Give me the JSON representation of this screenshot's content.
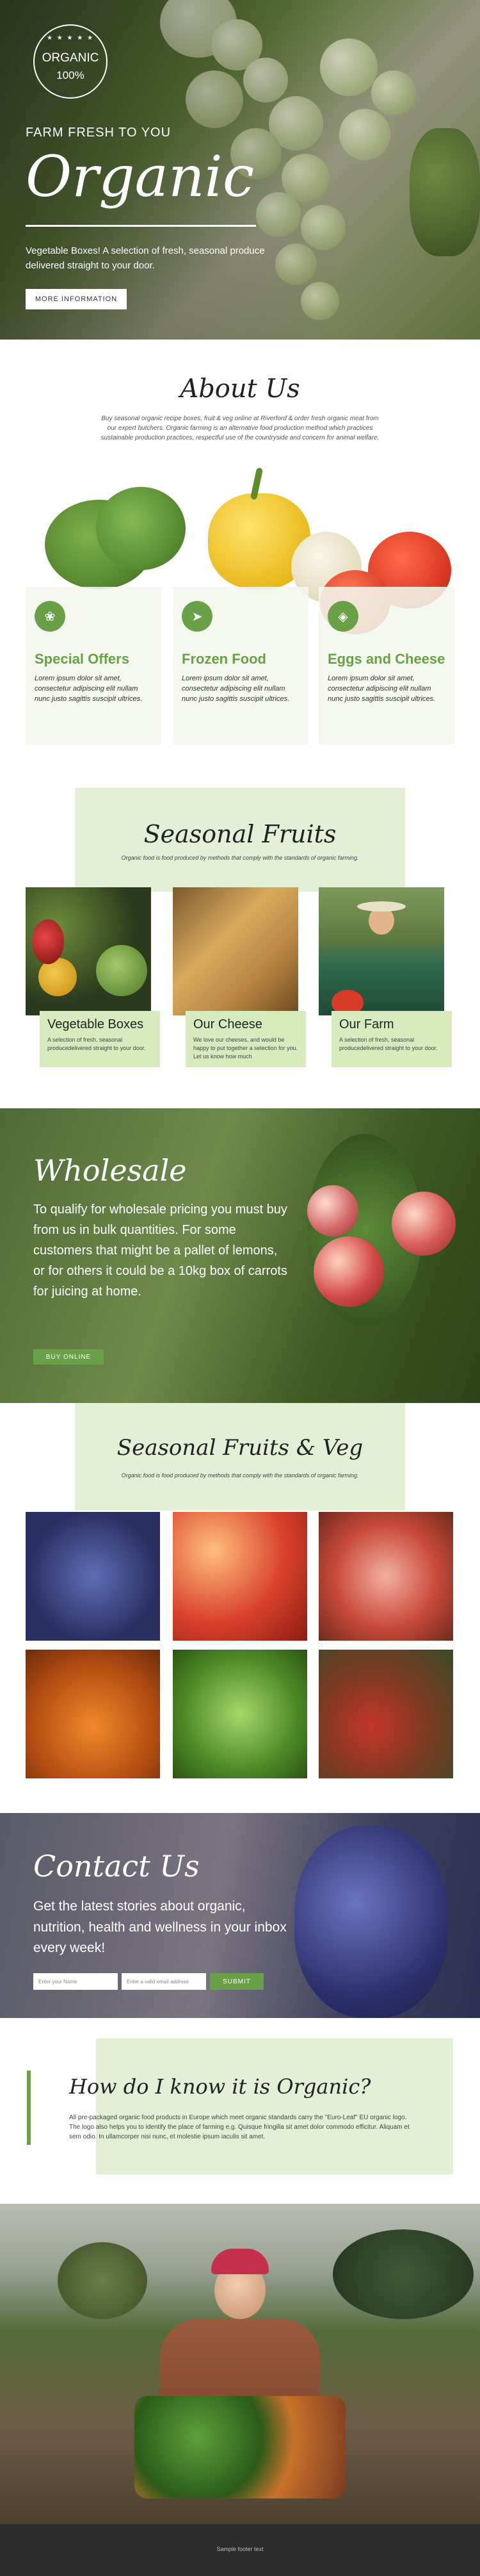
{
  "hero": {
    "logo_line1": "ORGANIC",
    "logo_line2": "100%",
    "logo_stars": "★ ★ ★ ★ ★",
    "kicker": "FARM FRESH TO YOU",
    "title": "Organic",
    "subtitle": "Vegetable Boxes! A selection of fresh, seasonal produce delivered straight to your door.",
    "button": "MORE INFORMATION"
  },
  "about": {
    "title": "About Us",
    "description": "Buy seasonal organic recipe boxes, fruit & veg online at Riverford & order fresh organic meat from our expert butchers. Organic farming is an alternative food production method which practices sustainable production practices, respectful use of the countryside and concern for animal welfare.",
    "cards": [
      {
        "icon": "broccoli-icon",
        "title": "Special Offers",
        "text": "Lorem ipsum dolor sit amet, consectetur adipiscing elit nullam nunc justo sagittis suscipit ultrices."
      },
      {
        "icon": "fish-icon",
        "title": "Frozen Food",
        "text": "Lorem ipsum dolor sit amet, consectetur adipiscing elit nullam nunc justo sagittis suscipit ultrices."
      },
      {
        "icon": "cheese-icon",
        "title": "Eggs and Cheese",
        "text": "Lorem ipsum dolor sit amet, consectetur adipiscing elit nullam nunc justo sagittis suscipit ultrices."
      }
    ]
  },
  "seasonal": {
    "title": "Seasonal Fruits",
    "description": "Organic food is food produced by methods that comply with the standards of organic farming.",
    "items": [
      {
        "title": "Vegetable Boxes",
        "text": "A selection of fresh, seasonal producedelivered straight to your door."
      },
      {
        "title": "Our Cheese",
        "text": "We love our cheeses, and would be happy to put together a selection for you. Let us know how much"
      },
      {
        "title": "Our Farm",
        "text": "A selection of fresh, seasonal producedelivered straight to your door."
      }
    ]
  },
  "wholesale": {
    "title": "Wholesale",
    "text": "To qualify for wholesale pricing you must buy from us in bulk quantities. For some customers that might be a pallet of lemons, or for others it could be a 10kg box of carrots for juicing at home.",
    "button": "BUY ONLINE"
  },
  "fv": {
    "title": "Seasonal Fruits & Veg",
    "description": "Organic food is food produced by methods that comply with the standards of organic farming."
  },
  "contact": {
    "title": "Contact Us",
    "text": "Get the latest stories about organic, nutrition, health and wellness in your inbox every week!",
    "name_placeholder": "Enter your Name",
    "email_placeholder": "Enter a valid email address",
    "button": "SUBMIT"
  },
  "organic_q": {
    "title": "How do I know it is Organic?",
    "text": "All pre-packaged organic food products in Europe which meet organic standards carry the \"Euro-Leaf\" EU organic logo. The logo also helps you to identify the place of farming e.g. Quisque fringilla sit amet dolor commodo efficitur. Aliquam et sem odio. In ullamcorper nisi nunc, et molestie ipsum iaculis sit amet."
  },
  "footer": {
    "text": "Sample footer text"
  }
}
